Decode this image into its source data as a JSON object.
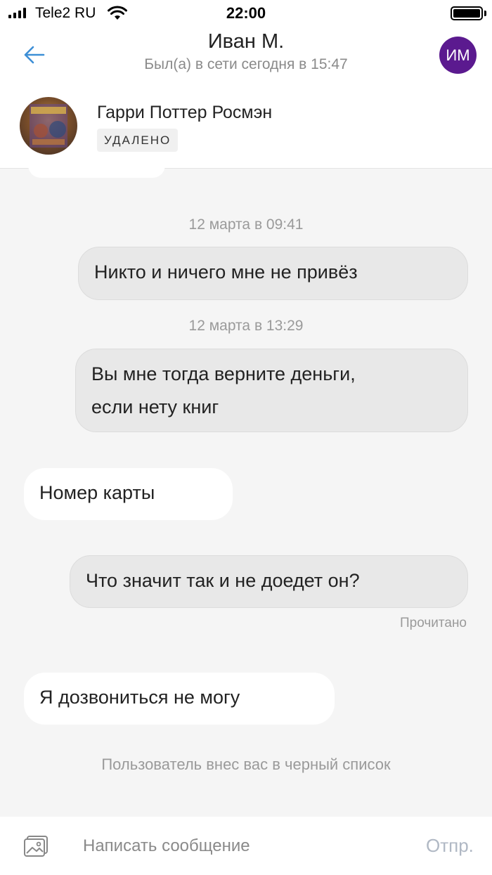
{
  "status_bar": {
    "carrier": "Tele2 RU",
    "time": "22:00"
  },
  "header": {
    "contact_name": "Иван М.",
    "last_seen": "Был(а) в сети сегодня в 15:47",
    "avatar_initials": "ИМ",
    "avatar_color": "#5b1a8f",
    "accent_color": "#3d8fd6"
  },
  "product": {
    "title": "Гарри Поттер Росмэн",
    "status": "УДАЛЕНО"
  },
  "messages": [
    {
      "type": "timestamp",
      "text": "12 марта в 09:41"
    },
    {
      "type": "outgoing",
      "text": "Никто и ничего мне не привёз"
    },
    {
      "type": "timestamp",
      "text": "12 марта в 13:29"
    },
    {
      "type": "outgoing",
      "lines": [
        "Вы мне тогда верните деньги,",
        "если нету книг"
      ]
    },
    {
      "type": "incoming",
      "text": "Номер карты"
    },
    {
      "type": "outgoing",
      "text": "Что значит так и не доедет он?"
    },
    {
      "type": "incoming",
      "text": "Я дозвониться не могу"
    }
  ],
  "read_status": "Прочитано",
  "system_note": "Пользователь внес вас в черный список",
  "composer": {
    "placeholder": "Написать сообщение",
    "send_label": "Отпр."
  }
}
